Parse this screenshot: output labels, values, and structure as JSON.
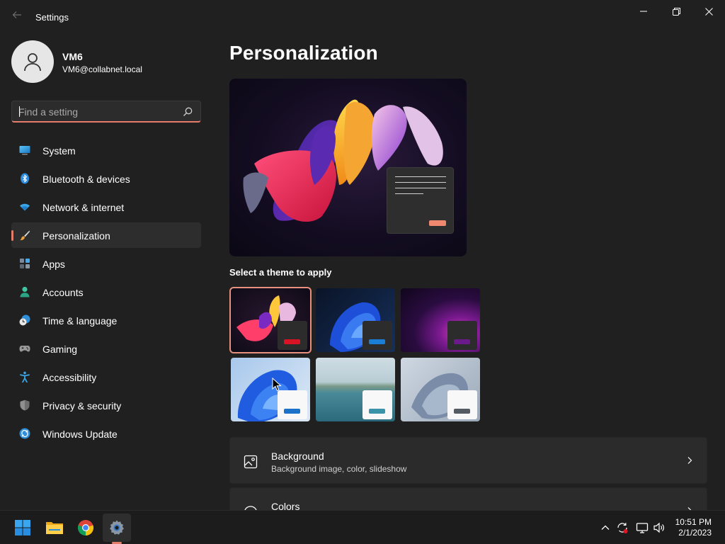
{
  "window": {
    "title": "Settings",
    "controls": [
      "minimize",
      "restore",
      "close"
    ]
  },
  "profile": {
    "name": "VM6",
    "email": "VM6@collabnet.local"
  },
  "search": {
    "placeholder": "Find a setting",
    "value": ""
  },
  "nav": {
    "items": [
      {
        "label": "System",
        "icon": "system-icon",
        "selected": false
      },
      {
        "label": "Bluetooth & devices",
        "icon": "bluetooth-icon",
        "selected": false
      },
      {
        "label": "Network & internet",
        "icon": "wifi-icon",
        "selected": false
      },
      {
        "label": "Personalization",
        "icon": "brush-icon",
        "selected": true
      },
      {
        "label": "Apps",
        "icon": "apps-icon",
        "selected": false
      },
      {
        "label": "Accounts",
        "icon": "person-icon",
        "selected": false
      },
      {
        "label": "Time & language",
        "icon": "globe-clock-icon",
        "selected": false
      },
      {
        "label": "Gaming",
        "icon": "gamepad-icon",
        "selected": false
      },
      {
        "label": "Accessibility",
        "icon": "accessibility-icon",
        "selected": false
      },
      {
        "label": "Privacy & security",
        "icon": "shield-icon",
        "selected": false
      },
      {
        "label": "Windows Update",
        "icon": "update-icon",
        "selected": false
      }
    ]
  },
  "main": {
    "title": "Personalization",
    "themes_label": "Select a theme to apply",
    "themes": [
      {
        "name": "glow-dark",
        "accent": "#d81424",
        "selected": true
      },
      {
        "name": "bloom-dark",
        "accent": "#1a7fd4",
        "selected": false
      },
      {
        "name": "sunrise-dark",
        "accent": "#6a1a8a",
        "selected": false
      },
      {
        "name": "bloom-light",
        "accent": "#1a73c8",
        "selected": false
      },
      {
        "name": "lake-light",
        "accent": "#3a93a8",
        "selected": false
      },
      {
        "name": "flow-light",
        "accent": "#555b63",
        "selected": false
      }
    ],
    "cards": [
      {
        "title": "Background",
        "subtitle": "Background image, color, slideshow",
        "icon": "image-icon"
      },
      {
        "title": "Colors",
        "subtitle": "",
        "icon": "palette-icon"
      }
    ]
  },
  "taskbar": {
    "apps": [
      "windows-start-icon",
      "file-explorer-icon",
      "chrome-icon",
      "settings-icon"
    ],
    "time": "10:51 PM",
    "date": "2/1/2023"
  },
  "colors": {
    "accent": "#e47b6b",
    "background": "#202020",
    "card": "#2b2b2b"
  }
}
